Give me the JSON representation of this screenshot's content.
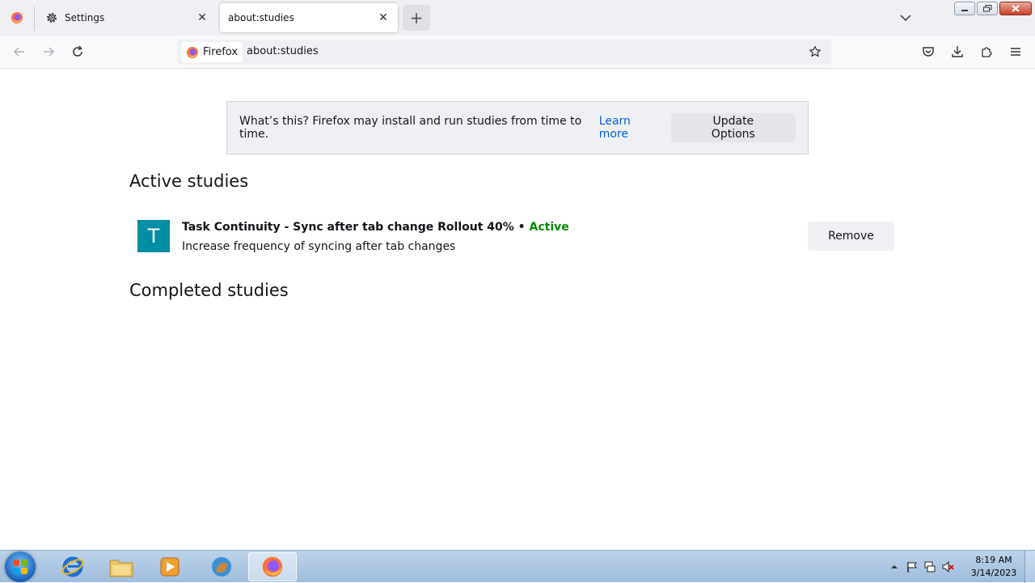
{
  "tabs": [
    {
      "title": "Settings",
      "icon": "gear-icon",
      "selected": false
    },
    {
      "title": "about:studies",
      "icon": "",
      "selected": true
    }
  ],
  "navbar": {
    "identity_label": "Firefox",
    "url": "about:studies"
  },
  "info_box": {
    "text": "What’s this? Firefox may install and run studies from time to time.",
    "learn_more": "Learn more",
    "update_options": "Update Options"
  },
  "active_section": {
    "heading": "Active studies",
    "studies": [
      {
        "icon_letter": "T",
        "title": "Task Continuity - Sync after tab change Rollout 40%",
        "separator": " • ",
        "status": "Active",
        "description": "Increase frequency of syncing after tab changes",
        "remove_label": "Remove"
      }
    ]
  },
  "completed_section": {
    "heading": "Completed studies"
  },
  "taskbar": {
    "clock_time": "8:19 AM",
    "clock_date": "3/14/2023"
  },
  "colors": {
    "accent_link": "#0061e0",
    "status_active": "#058b00",
    "study_icon": "#008ea4"
  }
}
